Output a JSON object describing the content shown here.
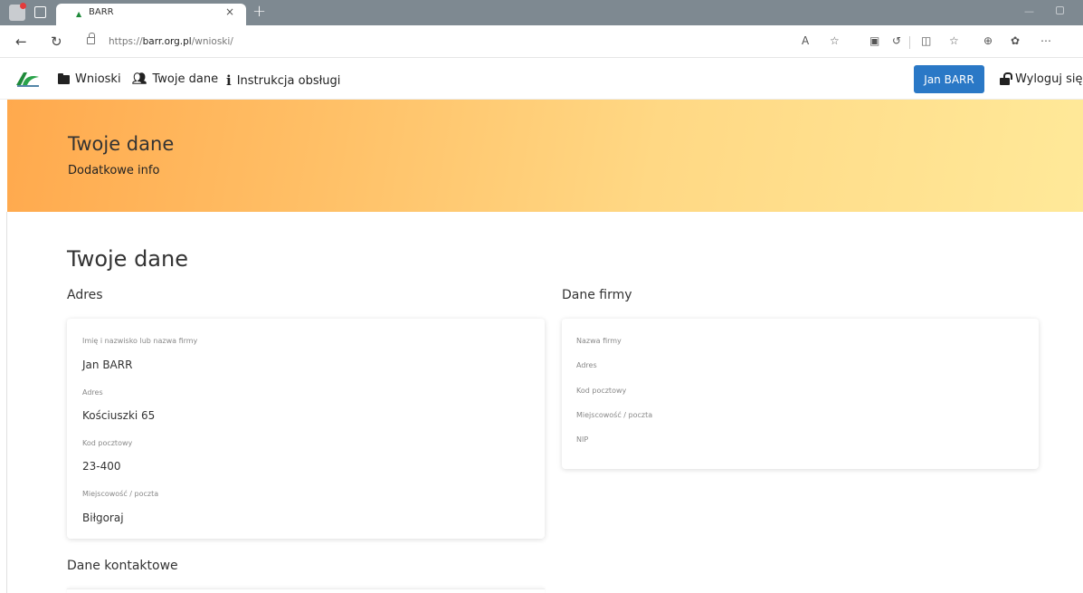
{
  "browser": {
    "tab_title": "BARR",
    "url_prefix": "https://",
    "url_domain": "barr.org.pl",
    "url_path": "/wnioski/"
  },
  "nav": {
    "links": [
      {
        "label": "Wnioski",
        "icon": "folder-icon"
      },
      {
        "label": "Twoje dane",
        "icon": "users-cog-icon"
      },
      {
        "label": "Instrukcja obsługi",
        "icon": "info-icon"
      }
    ],
    "user_button": "Jan BARR",
    "logout_label": "Wyloguj się"
  },
  "hero": {
    "title": "Twoje dane",
    "subtitle": "Dodatkowe info"
  },
  "page": {
    "heading": "Twoje dane",
    "address_section": {
      "title": "Adres",
      "fields": [
        {
          "label": "Imię i nazwisko lub nazwa firmy",
          "value": "Jan BARR"
        },
        {
          "label": "Adres",
          "value": "Kościuszki 65"
        },
        {
          "label": "Kod pocztowy",
          "value": "23-400"
        },
        {
          "label": "Miejscowość / poczta",
          "value": "Biłgoraj"
        }
      ]
    },
    "company_section": {
      "title": "Dane firmy",
      "fields": [
        {
          "label": "Nazwa firmy",
          "value": ""
        },
        {
          "label": "Adres",
          "value": ""
        },
        {
          "label": "Kod pocztowy",
          "value": ""
        },
        {
          "label": "Miejscowość / poczta",
          "value": ""
        },
        {
          "label": "NIP",
          "value": ""
        }
      ]
    },
    "contact_section": {
      "title": "Dane kontaktowe"
    }
  },
  "colors": {
    "primary_button": "#2a78c6",
    "hero_start": "#ffa94d",
    "hero_end": "#ffe999"
  }
}
